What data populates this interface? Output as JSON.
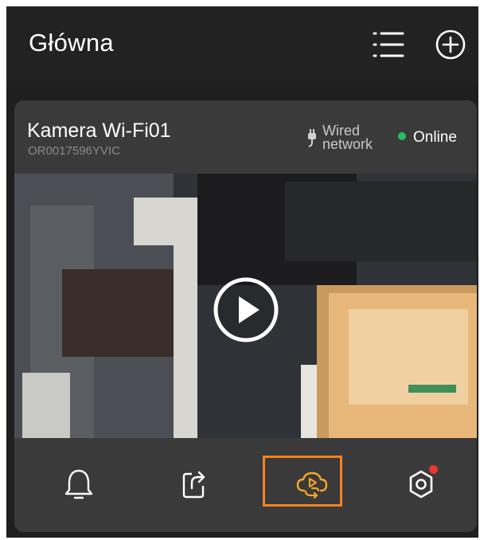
{
  "header": {
    "title": "Główna",
    "icons": [
      "list-icon",
      "add-circle-icon"
    ]
  },
  "camera": {
    "name": "Kamera Wi-Fi01",
    "serial": "OR0017596YVIC",
    "network": {
      "label_line1": "Wired",
      "label_line2": "network",
      "icon": "plug-icon"
    },
    "status": {
      "label": "Online",
      "color": "#21c063"
    }
  },
  "video": {
    "play_icon": "play-circle-icon"
  },
  "toolbar": {
    "items": [
      {
        "name": "alarm",
        "icon": "bell-icon"
      },
      {
        "name": "share",
        "icon": "share-icon"
      },
      {
        "name": "cloud-playback",
        "icon": "cloud-playback-icon",
        "selected": true
      },
      {
        "name": "settings",
        "icon": "settings-icon",
        "has_badge": true
      }
    ],
    "accent_color": "#f5a623",
    "highlight_color": "#f5821f",
    "badge_color": "#e8372e"
  }
}
